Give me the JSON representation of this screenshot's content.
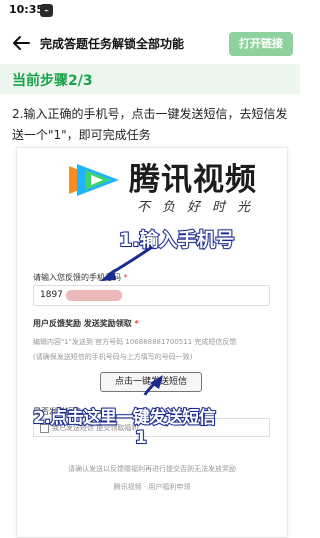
{
  "status_bar": {
    "time": "10:35",
    "badge": "⌁",
    "right": ""
  },
  "header": {
    "title": "完成答题任务解锁全部功能",
    "open_button": "打开链接"
  },
  "step": {
    "label": "当前步骤2/3"
  },
  "instruction": "2.输入正确的手机号，点击一键发送短信，去短信发送一个\"1\"，即可完成任务",
  "form": {
    "logo_text": "腾讯视频",
    "logo_slogan": "不负好时光",
    "annotation_1": "1.输入手机号",
    "phone_label": "请输入您反馈的手机号码",
    "required_mark": "*",
    "phone_value": "1897",
    "reward_label": "用户反馈奖励 发送奖励领取",
    "reward_required": "*",
    "hint_1": "编辑内容\"1\"发送到 官方号码 106888881700511 完成短信反馈",
    "hint_2": "(请确保发送短信的手机号码与上方填写的号码一致)",
    "send_button": "点击一键发送短信",
    "sent_label": "是否发送短信",
    "sent_required": "*",
    "annotation_2a": "2.点击这里一键发送短信",
    "annotation_2b": "1",
    "check_text": "我已发送短信 提交领取福利",
    "footer_1": "请确认发送以反馈赠福利再进行提交否则无法发放奖励",
    "footer_2": "腾讯视频 · 用户福利申领"
  },
  "colors": {
    "accent_green": "#1aa34a",
    "button_green": "#8fd19e",
    "annotation_blue": "#1a2c8c",
    "required_red": "#e53935"
  }
}
